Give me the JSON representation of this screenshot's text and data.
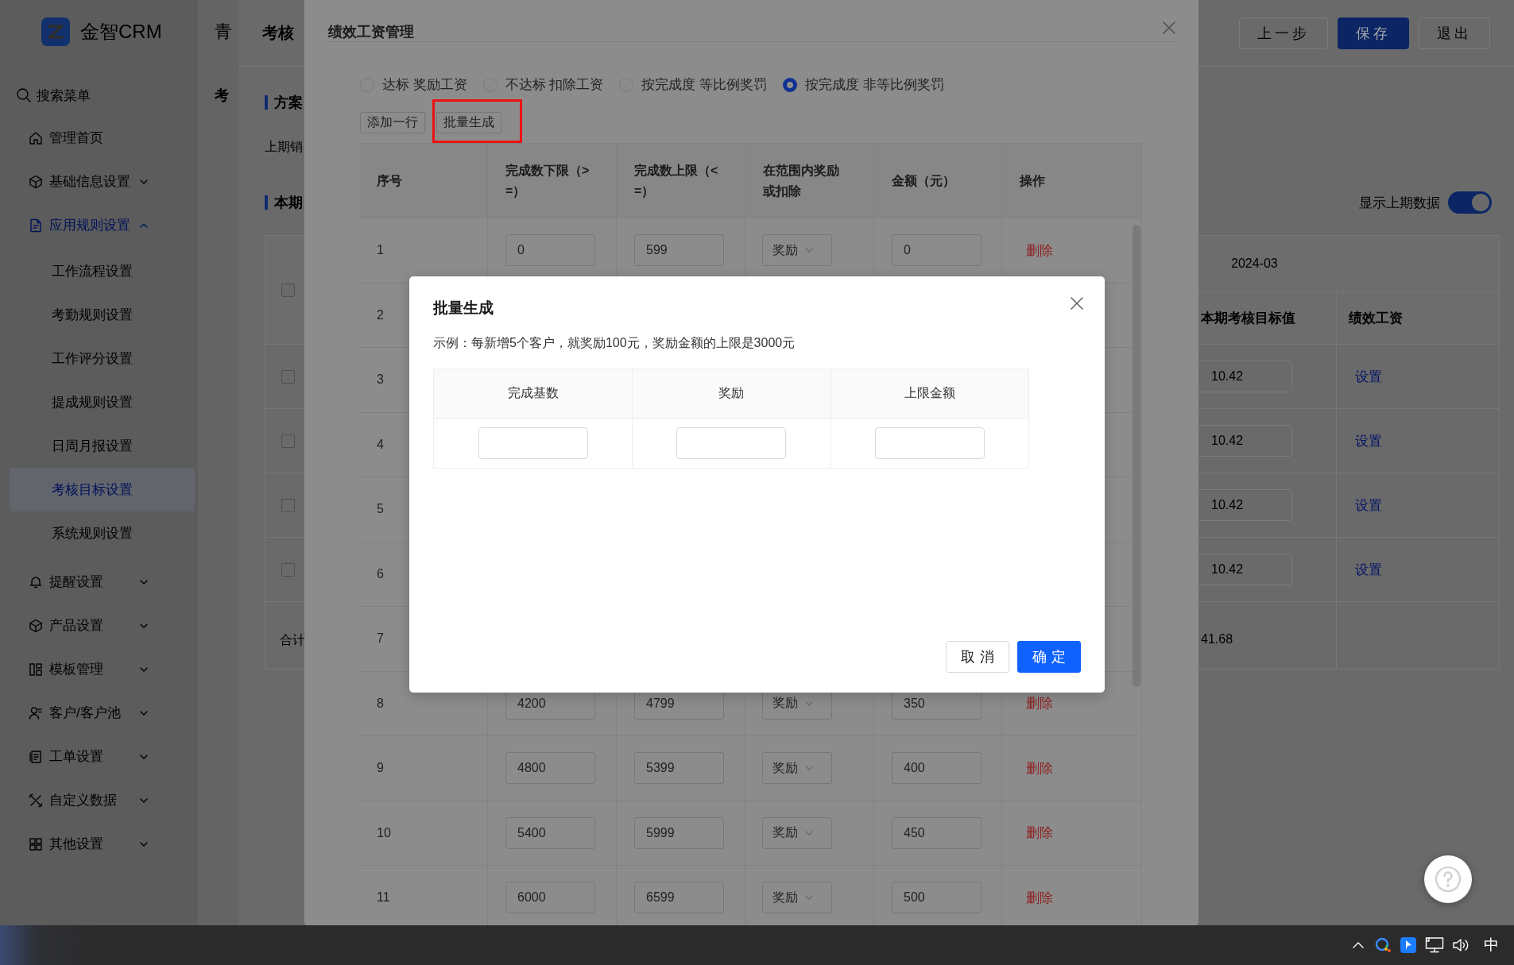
{
  "sidebar": {
    "logo_text": "金智CRM",
    "search": {
      "placeholder": "搜索菜单"
    },
    "items": [
      {
        "label": "管理首页"
      },
      {
        "label": "基础信息设置",
        "expanded": false
      },
      {
        "label": "应用规则设置",
        "expanded": true,
        "children": [
          {
            "label": "工作流程设置",
            "selected": false
          },
          {
            "label": "考勤规则设置",
            "selected": false
          },
          {
            "label": "工作评分设置",
            "selected": false
          },
          {
            "label": "提成规则设置",
            "selected": false
          },
          {
            "label": "日周月报设置",
            "selected": false
          },
          {
            "label": "考核目标设置",
            "selected": true
          },
          {
            "label": "系统规则设置",
            "selected": false
          }
        ]
      },
      {
        "label": "提醒设置",
        "expanded": false
      },
      {
        "label": "产品设置",
        "expanded": false
      },
      {
        "label": "模板管理",
        "expanded": false
      },
      {
        "label": "客户/客户池",
        "expanded": false
      },
      {
        "label": "工单设置",
        "expanded": false
      },
      {
        "label": "自定义数据",
        "expanded": false
      },
      {
        "label": "其他设置",
        "expanded": false
      }
    ]
  },
  "back_page": {
    "tab": "青",
    "title": "考"
  },
  "drawer": {
    "title": "考核",
    "buttons": [
      {
        "label": "上一步",
        "primary": false
      },
      {
        "label": "保存",
        "primary": true
      },
      {
        "label": "退出",
        "primary": false
      }
    ],
    "section_1": "方案",
    "previous_label": "上期销",
    "section_2": "本期",
    "show_previous": {
      "label": "显示上期数据",
      "on": true
    },
    "table": {
      "all_checked": false,
      "period": "2024-03",
      "columns": [
        "本期考核目标值",
        "绩效工资"
      ],
      "rows": [
        {
          "checked": false,
          "target": "10.42",
          "action": "设置"
        },
        {
          "checked": false,
          "target": "10.42",
          "action": "设置"
        },
        {
          "checked": false,
          "target": "10.42",
          "action": "设置"
        },
        {
          "checked": false,
          "target": "10.42",
          "action": "设置"
        }
      ],
      "total_label": "合计",
      "total": "41.68"
    }
  },
  "dialog": {
    "title": "绩效工资管理",
    "modes": [
      {
        "label": "达标 奖励工资",
        "selected": false
      },
      {
        "label": "不达标 扣除工资",
        "selected": false
      },
      {
        "label": "按完成度 等比例奖罚",
        "selected": false
      },
      {
        "label": "按完成度 非等比例奖罚",
        "selected": true
      }
    ],
    "buttons": [
      {
        "label": "添加一行",
        "highlighted": false
      },
      {
        "label": "批量生成",
        "highlighted": true
      }
    ],
    "table": {
      "columns": [
        "序号",
        "完成数下限（>=）",
        "完成数上限（<=）",
        "在范围内奖励或扣除",
        "金额（元）",
        "操作"
      ],
      "rows": [
        {
          "index": "1",
          "min": "0",
          "max": "599",
          "type": "奖励",
          "amount": "0",
          "action": "删除"
        },
        {
          "index": "2"
        },
        {
          "index": "3"
        },
        {
          "index": "4"
        },
        {
          "index": "5"
        },
        {
          "index": "6"
        },
        {
          "index": "7"
        },
        {
          "index": "8",
          "min": "4200",
          "max": "4799",
          "type": "奖励",
          "amount": "350",
          "action": "删除"
        },
        {
          "index": "9",
          "min": "4800",
          "max": "5399",
          "type": "奖励",
          "amount": "400",
          "action": "删除"
        },
        {
          "index": "10",
          "min": "5400",
          "max": "5999",
          "type": "奖励",
          "amount": "450",
          "action": "删除"
        },
        {
          "index": "11",
          "min": "6000",
          "max": "6599",
          "type": "奖励",
          "amount": "500",
          "action": "删除"
        }
      ]
    }
  },
  "modal": {
    "title": "批量生成",
    "hint": "示例：每新增5个客户，就奖励100元，奖励金额的上限是3000元",
    "columns": [
      "完成基数",
      "奖励",
      "上限金额"
    ],
    "buttons": [
      {
        "label": "取消",
        "primary": false
      },
      {
        "label": "确定",
        "primary": true
      }
    ]
  },
  "taskbar": {
    "ime": "中"
  }
}
